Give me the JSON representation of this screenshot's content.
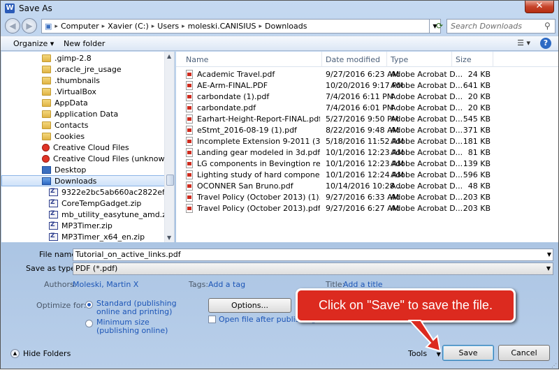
{
  "window": {
    "title": "Save As",
    "app_icon": "W",
    "close_label": "✕"
  },
  "address": {
    "crumbs": [
      "Computer",
      "Xavier (C:)",
      "Users",
      "moleski.CANISIUS",
      "Downloads"
    ],
    "search_placeholder": "Search Downloads"
  },
  "toolbar": {
    "organize": "Organize ▾",
    "new_folder": "New folder",
    "help": "?"
  },
  "nav": {
    "items": [
      {
        "label": ".gimp-2.8",
        "icon": "folder"
      },
      {
        "label": ".oracle_jre_usage",
        "icon": "folder"
      },
      {
        "label": ".thumbnails",
        "icon": "folder"
      },
      {
        "label": ".VirtualBox",
        "icon": "folder"
      },
      {
        "label": "AppData",
        "icon": "folder"
      },
      {
        "label": "Application Data",
        "icon": "folder"
      },
      {
        "label": "Contacts",
        "icon": "folder"
      },
      {
        "label": "Cookies",
        "icon": "folder"
      },
      {
        "label": "Creative Cloud Files",
        "icon": "creative-cloud"
      },
      {
        "label": "Creative Cloud Files (unknown)",
        "icon": "creative-cloud"
      },
      {
        "label": "Desktop",
        "icon": "desktop"
      },
      {
        "label": "Downloads",
        "icon": "downloads"
      },
      {
        "label": "9322e2bc5ab660ac2822ef0ae05dae02...",
        "icon": "zip"
      },
      {
        "label": "CoreTempGadget.zip",
        "icon": "zip"
      },
      {
        "label": "mb_utility_easytune_amd.zip",
        "icon": "zip"
      },
      {
        "label": "MP3Timer.zip",
        "icon": "zip"
      },
      {
        "label": "MP3Timer_x64_en.zip",
        "icon": "zip"
      }
    ]
  },
  "columns": {
    "name": "Name",
    "date": "Date modified",
    "type": "Type",
    "size": "Size"
  },
  "files": [
    {
      "name": "Academic Travel.pdf",
      "date": "9/27/2016 6:23 AM",
      "type": "Adobe Acrobat D...",
      "size": "24 KB"
    },
    {
      "name": "AE-Arm-FINAL.PDF",
      "date": "10/20/2016 9:17 PM",
      "type": "Adobe Acrobat D...",
      "size": "641 KB"
    },
    {
      "name": "carbondate (1).pdf",
      "date": "7/4/2016 6:11 PM",
      "type": "Adobe Acrobat D...",
      "size": "20 KB"
    },
    {
      "name": "carbondate.pdf",
      "date": "7/4/2016 6:01 PM",
      "type": "Adobe Acrobat D...",
      "size": "20 KB"
    },
    {
      "name": "Earhart-Height-Report-FINAL.pdf",
      "date": "5/27/2016 9:50 PM",
      "type": "Adobe Acrobat D...",
      "size": "545 KB"
    },
    {
      "name": "eStmt_2016-08-19 (1).pdf",
      "date": "8/22/2016 9:48 AM",
      "type": "Adobe Acrobat D...",
      "size": "371 KB"
    },
    {
      "name": "Incomplete Extension 9-2011 (3).pdf",
      "date": "5/18/2016 11:52 AM",
      "type": "Adobe Acrobat D...",
      "size": "181 KB"
    },
    {
      "name": "Landing gear modeled in 3d.pdf",
      "date": "10/1/2016 12:23 AM",
      "type": "Adobe Acrobat D...",
      "size": "81 KB"
    },
    {
      "name": "LG components in Bevingtion relation-8-...",
      "date": "10/1/2016 12:23 AM",
      "type": "Adobe Acrobat D...",
      "size": "139 KB"
    },
    {
      "name": "Lighting study of hard components and t...",
      "date": "10/1/2016 12:24 AM",
      "type": "Adobe Acrobat D...",
      "size": "596 KB"
    },
    {
      "name": "OCONNER San Bruno.pdf",
      "date": "10/14/2016 10:28 ...",
      "type": "Adobe Acrobat D...",
      "size": "48 KB"
    },
    {
      "name": "Travel Policy (October 2013) (1).pdf",
      "date": "9/27/2016 6:33 AM",
      "type": "Adobe Acrobat D...",
      "size": "203 KB"
    },
    {
      "name": "Travel Policy (October 2013).pdf",
      "date": "9/27/2016 6:27 AM",
      "type": "Adobe Acrobat D...",
      "size": "203 KB"
    }
  ],
  "form": {
    "file_name_label": "File name:",
    "file_name_value": "Tutorial_on_active_links.pdf",
    "save_type_label": "Save as type:",
    "save_type_value": "PDF (*.pdf)",
    "authors_label": "Authors:",
    "authors_value": "Moleski, Martin X",
    "tags_label": "Tags:",
    "tags_value": "Add a tag",
    "title_label": "Title:",
    "title_value": "Add a title",
    "optimize_label": "Optimize for:",
    "opt_standard_line1": "Standard (publishing",
    "opt_standard_line2": "online and printing)",
    "opt_minimum_line1": "Minimum size",
    "opt_minimum_line2": "(publishing online)",
    "options_button": "Options...",
    "open_after_label": "Open file after publishing"
  },
  "callout": {
    "text": "Click on \"Save\" to save the file."
  },
  "footer": {
    "hide_folders": "Hide Folders",
    "tools": "Tools",
    "save": "Save",
    "cancel": "Cancel"
  }
}
